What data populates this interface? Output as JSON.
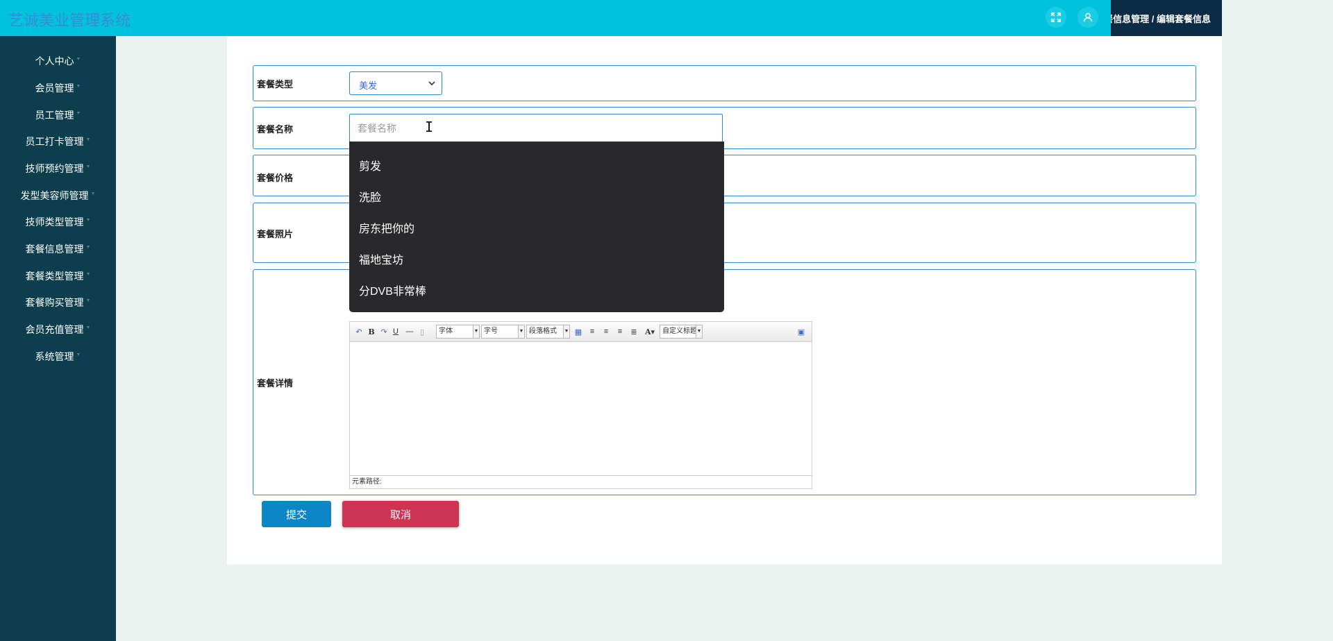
{
  "header": {
    "app_title": "艺诚美业管理系统",
    "breadcrumb": "套餐信息管理 / 编辑套餐信息",
    "fullscreen_icon": "expand-icon",
    "user_icon": "user-icon"
  },
  "sidebar": {
    "items": [
      {
        "label": "个人中心"
      },
      {
        "label": "会员管理"
      },
      {
        "label": "员工管理"
      },
      {
        "label": "员工打卡管理"
      },
      {
        "label": "技师预约管理"
      },
      {
        "label": "发型美容师管理"
      },
      {
        "label": "技师类型管理"
      },
      {
        "label": "套餐信息管理"
      },
      {
        "label": "套餐类型管理"
      },
      {
        "label": "套餐购买管理"
      },
      {
        "label": "会员充值管理"
      },
      {
        "label": "系统管理"
      }
    ]
  },
  "form": {
    "type_label": "套餐类型",
    "type_value": "美发",
    "name_label": "套餐名称",
    "name_placeholder": "套餐名称",
    "name_value": "",
    "price_label": "套餐价格",
    "photo_label": "套餐照片",
    "detail_label": "套餐详情",
    "autocomplete": [
      "剪发",
      "洗脸",
      "房东把你的",
      "福地宝坊",
      "分DVB非常棒"
    ],
    "editor": {
      "font_combo": "字体",
      "size_combo": "字号",
      "paragraph_combo": "段落格式",
      "custom_title_combo": "自定义标题",
      "status_text": "元素路径:"
    },
    "submit_label": "提交",
    "cancel_label": "取消"
  },
  "colors": {
    "header_bg": "#00c2dc",
    "sidebar_bg": "#0c3e4d",
    "accent_border": "#2a8bc5",
    "submit_bg": "#0c86c7",
    "cancel_bg": "#cc3452",
    "dropdown_bg": "#29292b"
  }
}
